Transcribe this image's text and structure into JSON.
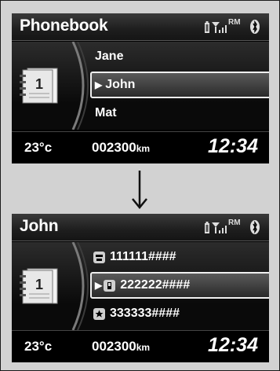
{
  "screen1": {
    "title": "Phonebook",
    "status": {
      "rm": "RM"
    },
    "items": [
      {
        "label": "Jane"
      },
      {
        "label": "John",
        "selected": true
      },
      {
        "label": "Mat"
      }
    ],
    "footer": {
      "temperature": "23°c",
      "odometer": "002300",
      "odometer_unit": "km",
      "time": "12:34"
    }
  },
  "screen2": {
    "title": "John",
    "status": {
      "rm": "RM"
    },
    "items": [
      {
        "label": "111111####",
        "icon": "home-phone-icon"
      },
      {
        "label": "222222####",
        "icon": "mobile-phone-icon",
        "selected": true
      },
      {
        "label": "333333####",
        "icon": "star-icon"
      }
    ],
    "footer": {
      "temperature": "23°c",
      "odometer": "002300",
      "odometer_unit": "km",
      "time": "12:34"
    }
  },
  "colors": {
    "screen_bg": "#000000",
    "panel_bg": "#d2d2d2",
    "text": "#ffffff"
  }
}
